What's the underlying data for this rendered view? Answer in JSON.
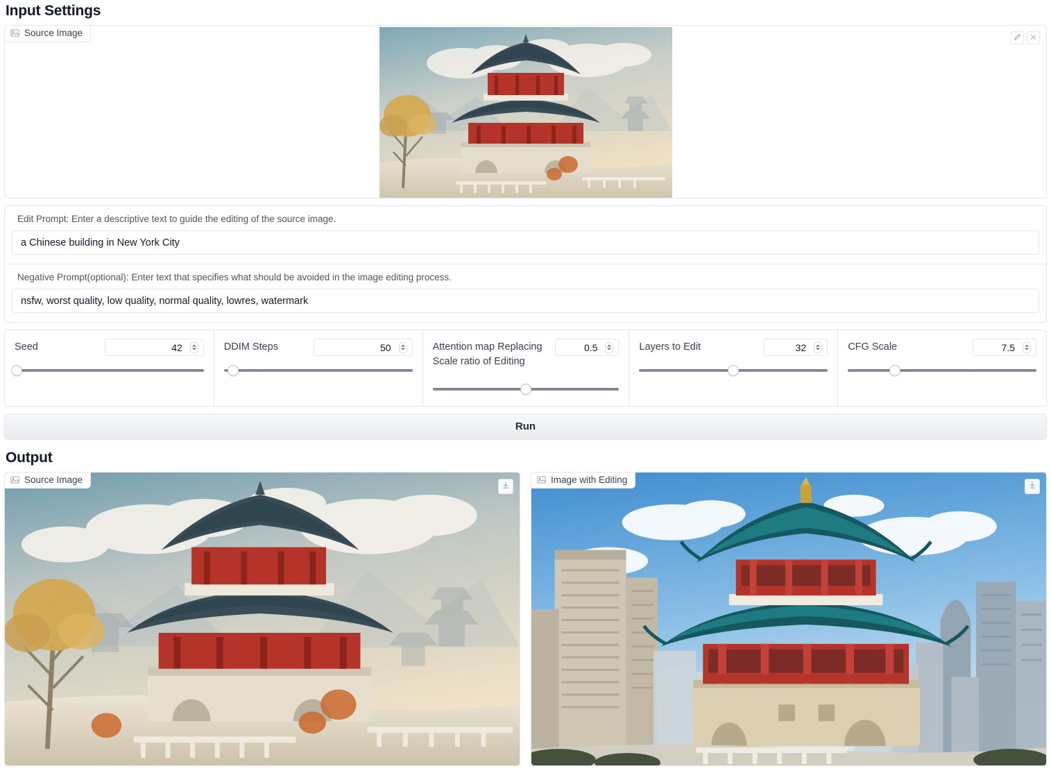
{
  "input_section": {
    "title": "Input Settings",
    "source_image": {
      "chip_label": "Source Image",
      "chip_icon": "image-icon",
      "edit_icon": "pencil-icon",
      "clear_icon": "close-icon"
    },
    "edit_prompt": {
      "label": "Edit Prompt: Enter a descriptive text to guide the editing of the source image.",
      "value": "a Chinese building in New York City",
      "placeholder": ""
    },
    "negative_prompt": {
      "label": "Negative Prompt(optional): Enter text that specifies what should be avoided in the image editing process.",
      "value": "nsfw, worst quality, low quality, normal quality, lowres, watermark",
      "placeholder": ""
    },
    "sliders": [
      {
        "label": "Seed",
        "value": "42",
        "fill_percent": 1
      },
      {
        "label": "DDIM Steps",
        "value": "50",
        "fill_percent": 5
      },
      {
        "label": "Attention map Replacing Scale ratio of Editing",
        "value": "0.5",
        "fill_percent": 50
      },
      {
        "label": "Layers to Edit",
        "value": "32",
        "fill_percent": 50
      },
      {
        "label": "CFG Scale",
        "value": "7.5",
        "fill_percent": 25
      }
    ],
    "run_button": "Run"
  },
  "output_section": {
    "title": "Output",
    "panels": [
      {
        "chip_label": "Source Image",
        "chip_icon": "image-icon",
        "download_icon": "download-icon"
      },
      {
        "chip_label": "Image with Editing",
        "chip_icon": "image-icon",
        "download_icon": "download-icon"
      }
    ]
  },
  "colors": {
    "border": "#e5e7eb",
    "text": "#1f2937",
    "muted": "#4b5563",
    "pagoda_red": "#b4342a",
    "pagoda_roof": "#2f4550",
    "roof_teal": "#1f6f78",
    "stone": "#d8cdb6"
  }
}
